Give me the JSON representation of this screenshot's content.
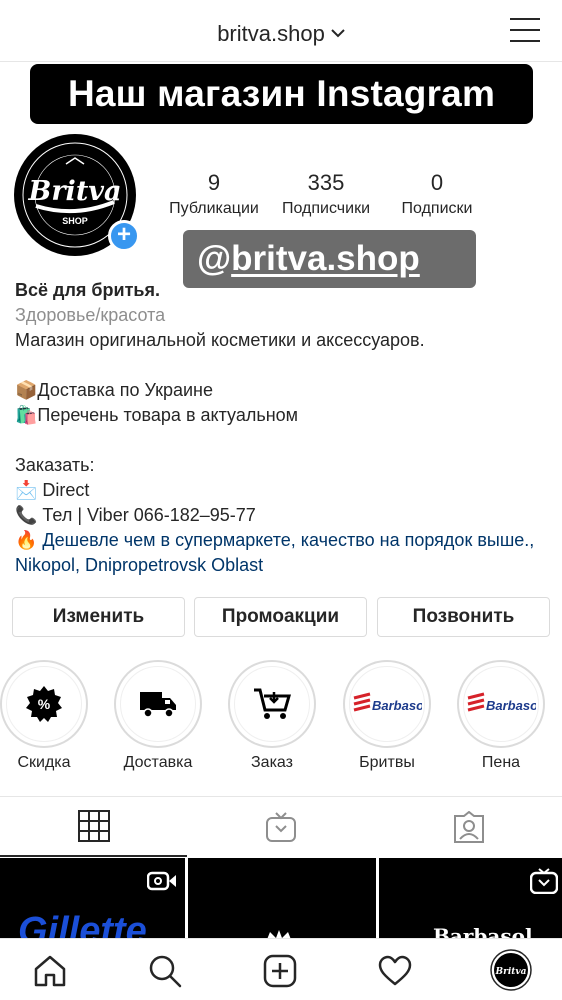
{
  "header": {
    "username": "britva.shop",
    "menu_icon": "hamburger-menu-icon",
    "chevron_icon": "chevron-down-icon"
  },
  "banner": {
    "text": "Наш магазин Instagram"
  },
  "profile": {
    "avatar": {
      "brand": "Britva",
      "sub": "SHOP",
      "ring_top": "ORIGINAL PRODUCTS",
      "ring_bottom": "FOR MEN'S & WOMEN'S"
    },
    "stats": [
      {
        "value": "9",
        "label": "Публикации"
      },
      {
        "value": "335",
        "label": "Подписчики"
      },
      {
        "value": "0",
        "label": "Подписки"
      }
    ]
  },
  "handle_overlay": {
    "at": "@",
    "name": "britva.shop"
  },
  "bio": {
    "name": "Всё для бритья.",
    "category": "Здоровье/красота",
    "description": "Магазин оригинальной косметики и аксессуаров.",
    "line_delivery": "Доставка по Украине",
    "line_list": "Перечень товара в актуальном",
    "order_title": "Заказать:",
    "line_direct": "Direct",
    "line_phone": "Тел | Viber 066-182–95-77",
    "line_cheaper": "Дешевле чем в супермаркете, качество на порядок выше.",
    "location": ", Nikopol, Dnipropetrovsk Oblast"
  },
  "actions": {
    "edit": "Изменить",
    "promo": "Промоакции",
    "call": "Позвонить"
  },
  "highlights": [
    {
      "label": "Скидка",
      "icon": "discount-badge-icon"
    },
    {
      "label": "Доставка",
      "icon": "delivery-truck-icon"
    },
    {
      "label": "Заказ",
      "icon": "shopping-cart-icon"
    },
    {
      "label": "Бритвы",
      "icon": "barbasol-logo-icon",
      "logo_text": "Barbasol"
    },
    {
      "label": "Пена",
      "icon": "barbasol-logo-icon",
      "logo_text": "Barbasol"
    }
  ],
  "grid_posts": [
    {
      "text": "Gillette"
    },
    {
      "text": ""
    },
    {
      "text": "Barbasol"
    }
  ],
  "colors": {
    "accent": "#3897f0",
    "link": "#003569",
    "text": "#262626",
    "muted": "#8e8e8e"
  }
}
